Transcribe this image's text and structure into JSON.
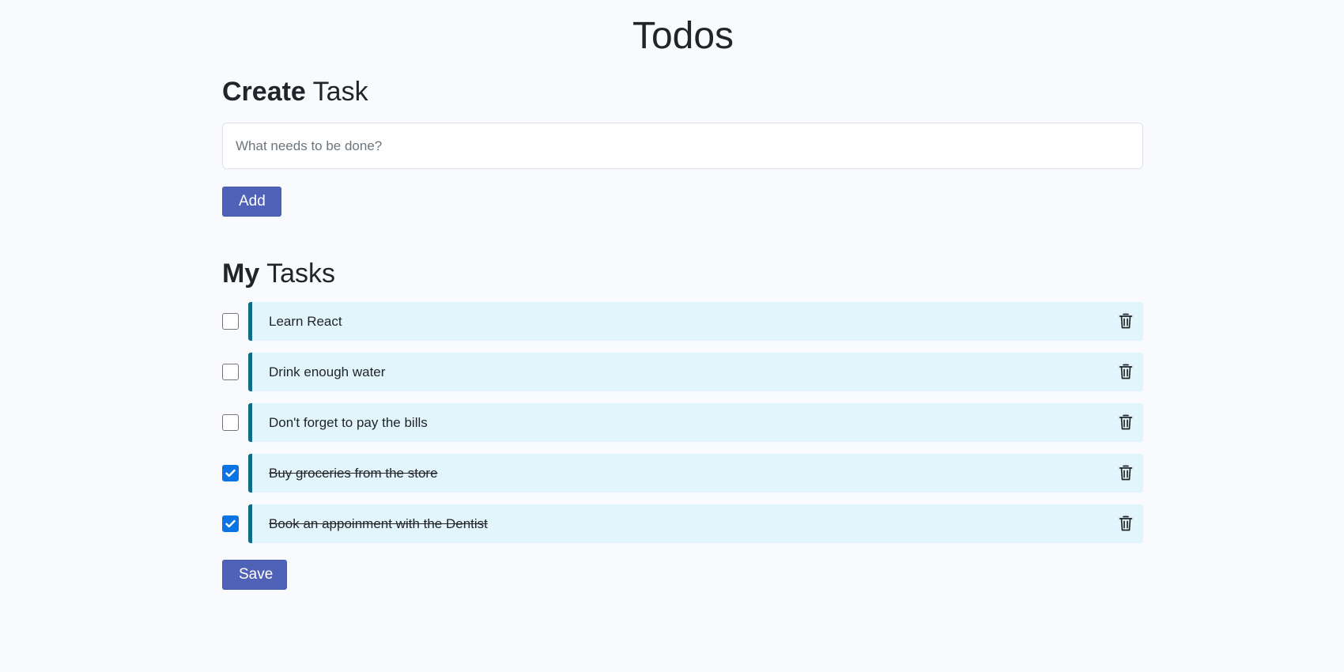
{
  "page": {
    "title": "Todos"
  },
  "create": {
    "heading_bold": "Create",
    "heading_rest": " Task",
    "input_placeholder": "What needs to be done?",
    "input_value": "",
    "add_label": "Add"
  },
  "tasks": {
    "heading_bold": "My",
    "heading_rest": " Tasks",
    "items": [
      {
        "text": "Learn React",
        "done": false
      },
      {
        "text": "Drink enough water",
        "done": false
      },
      {
        "text": "Don't forget to pay the bills",
        "done": false
      },
      {
        "text": "Buy groceries from the store",
        "done": true
      },
      {
        "text": "Book an appoinment with the Dentist",
        "done": true
      }
    ],
    "save_label": "Save",
    "item_icon": "trash-icon"
  },
  "colors": {
    "background": "#f8fafe",
    "button": "#4f62b8",
    "task_card": "#e3f5fc",
    "task_accent": "#0f6b89",
    "checkbox_checked": "#0b74e5"
  }
}
